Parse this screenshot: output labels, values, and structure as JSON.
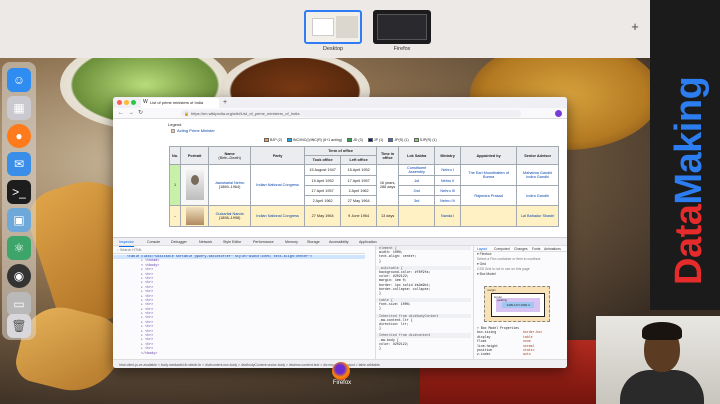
{
  "mission_control": {
    "spaces": [
      {
        "label": "Desktop"
      },
      {
        "label": "Firefox"
      }
    ],
    "add_space_glyph": "+"
  },
  "brand": {
    "part1": "Data",
    "part2": "Making"
  },
  "dock_icons": [
    "finder-icon",
    "launchpad-icon",
    "firefox-icon",
    "mail-icon",
    "terminal-icon",
    "preview-icon",
    "atom-icon",
    "obs-icon",
    "disk-icon",
    "trash-icon"
  ],
  "browser": {
    "tab_title": "List of prime ministers of India",
    "url": "https://en.wikipedia.org/wiki/List_of_prime_ministers_of_India",
    "legend_title": "Legend",
    "legend_acting": "Acting Prime Minister",
    "parties": [
      {
        "name": "BJP",
        "count": "(2)",
        "color": "#f6a04d"
      },
      {
        "name": "INC/INC(I)/INC(R)",
        "count": "(6+1 acting)",
        "color": "#19aaed"
      },
      {
        "name": "JD",
        "count": "(3)",
        "color": "#2aa44a"
      },
      {
        "name": "JP",
        "count": "(1)",
        "color": "#0b1a8a"
      },
      {
        "name": "JP(S)",
        "count": "(1)",
        "color": "#3a68c2"
      },
      {
        "name": "SJP(R)",
        "count": "(1)",
        "color": "#8ad06a"
      }
    ],
    "table": {
      "headers": {
        "no": "No.",
        "portrait": "Portrait",
        "name": "Name",
        "name_sub": "(Birth–Death)",
        "party": "Party",
        "term": "Term of office",
        "took_office": "Took office",
        "left_office": "Left office",
        "time_in_office": "Time in office",
        "lok_sabha": "Lok Sabha",
        "ministry": "Ministry",
        "appointed_by": "Appointed by",
        "senior_advisor": "Senior Advisor"
      },
      "rows": [
        {
          "no": "1",
          "name": "Jawaharlal Nehru",
          "years": "(1889–1964)",
          "party": "Indian National Congress",
          "time_in_office": "16 years, 286 days",
          "appointed_by_1": "The Earl Mountbatten of Burma",
          "appointed_by_2": "Rajendra Prasad",
          "advisor_1": "Mahatma Gandhi Indira Gandhi",
          "advisor_2": "Indira Gandhi",
          "terms": [
            {
              "took": "15 August 1947",
              "left": "15 April 1952",
              "lok": "Constituent Assembly",
              "ministry": "Nehru I"
            },
            {
              "took": "15 April 1952",
              "left": "17 April 1957",
              "lok": "1st",
              "ministry": "Nehru II"
            },
            {
              "took": "17 April 1957",
              "left": "2 April 1962",
              "lok": "2nd",
              "ministry": "Nehru III"
            },
            {
              "took": "2 April 1962",
              "left": "27 May 1964",
              "lok": "3rd",
              "ministry": "Nehru IV"
            }
          ]
        },
        {
          "no": "–",
          "name": "Gulzarilal Nanda",
          "years": "(1898–1998)",
          "party": "Indian National Congress",
          "took": "27 May 1964",
          "left": "9 June 1964",
          "time_in_office": "13 days",
          "ministry": "Nanda I",
          "advisor": "Lal Bahadur Shastri"
        }
      ]
    }
  },
  "devtools": {
    "tabs": [
      "Inspector",
      "Console",
      "Debugger",
      "Network",
      "Style Editor",
      "Performance",
      "Memory",
      "Storage",
      "Accessibility",
      "Application"
    ],
    "search_placeholder": "Search HTML",
    "selected_node": "<table class=\"wikitable sortable jquery-tablesorter\" style=\"width:100%; text-align:center\">",
    "dom_lines": [
      "▸ <thead>",
      "▾ <tbody>",
      "  ▸ <tr>",
      "  ▸ <tr>",
      "  ▸ <tr>",
      "  ▸ <tr>",
      "  ▸ <tr>",
      "  ▸ <tr>",
      "  ▸ <tr>",
      "  ▸ <tr>",
      "  ▸ <tr>",
      "  ▸ <tr>",
      "  ▸ <tr>",
      "  ▸ <tr>",
      "  ▸ <tr>",
      "  ▸ <tr>",
      "  ▸ <tr>",
      "  ▸ <tr>",
      "  ▸ <tr>",
      "  ▸ <tr>",
      "  ▸ <tr>",
      "  </tbody>"
    ],
    "rules": [
      {
        "t": "hdr",
        "s": "element  {"
      },
      {
        "t": "",
        "s": "  width: 100%;"
      },
      {
        "t": "",
        "s": "  text-align: center;"
      },
      {
        "t": "",
        "s": "}"
      },
      {
        "t": "gap",
        "s": ""
      },
      {
        "t": "hdr",
        "s": ".wikitable  {"
      },
      {
        "t": "",
        "s": "  background-color: #f8f9fa;"
      },
      {
        "t": "",
        "s": "  color: #202122;"
      },
      {
        "t": "",
        "s": "  margin: 1em 0;"
      },
      {
        "t": "",
        "s": "  border: 1px solid #a2a9b1;"
      },
      {
        "t": "",
        "s": "  border-collapse: collapse;"
      },
      {
        "t": "",
        "s": "}"
      },
      {
        "t": "gap",
        "s": ""
      },
      {
        "t": "hdr",
        "s": "table  {"
      },
      {
        "t": "",
        "s": "  font-size: 100%;"
      },
      {
        "t": "",
        "s": "}"
      },
      {
        "t": "gap",
        "s": ""
      },
      {
        "t": "hdr",
        "s": "Inherited from div#bodyContent"
      },
      {
        "t": "",
        "s": ".mw-content-ltr  {"
      },
      {
        "t": "",
        "s": "  direction: ltr;"
      },
      {
        "t": "",
        "s": "}"
      },
      {
        "t": "gap",
        "s": ""
      },
      {
        "t": "hdr",
        "s": "Inherited from div#content"
      },
      {
        "t": "",
        "s": ".mw-body  {"
      },
      {
        "t": "",
        "s": "  color: #202122;"
      },
      {
        "t": "",
        "s": "}"
      }
    ],
    "layout_tabs": [
      "Layout",
      "Computed",
      "Changes",
      "Fonts",
      "Animations"
    ],
    "layout_sections": [
      "▾ Flexbox",
      "Select a Flex container or item to continue.",
      "▾ Grid",
      "CSS Grid is not in use on this page",
      "▾ Box Model"
    ],
    "box": {
      "margin": "margin",
      "border": "border",
      "padding": "padding",
      "content": "1405.117×1000.4"
    },
    "props_title": "▾ Box Model Properties",
    "props": [
      {
        "k": "box-sizing",
        "v": "border-box"
      },
      {
        "k": "display",
        "v": "table"
      },
      {
        "k": "float",
        "v": "none"
      },
      {
        "k": "line-height",
        "v": "normal"
      },
      {
        "k": "position",
        "v": "static"
      },
      {
        "k": "z-index",
        "v": "auto"
      }
    ],
    "breadcrumb": "html.client-js.ve-available > body.mediawiki.ltr.sitedir-ltr > div#content.mw-body > div#bodyContent.vector-body > div#mw-content-text > div.mw-parser-output > table.wikitable"
  },
  "firefox_dock_label": "Firefox"
}
